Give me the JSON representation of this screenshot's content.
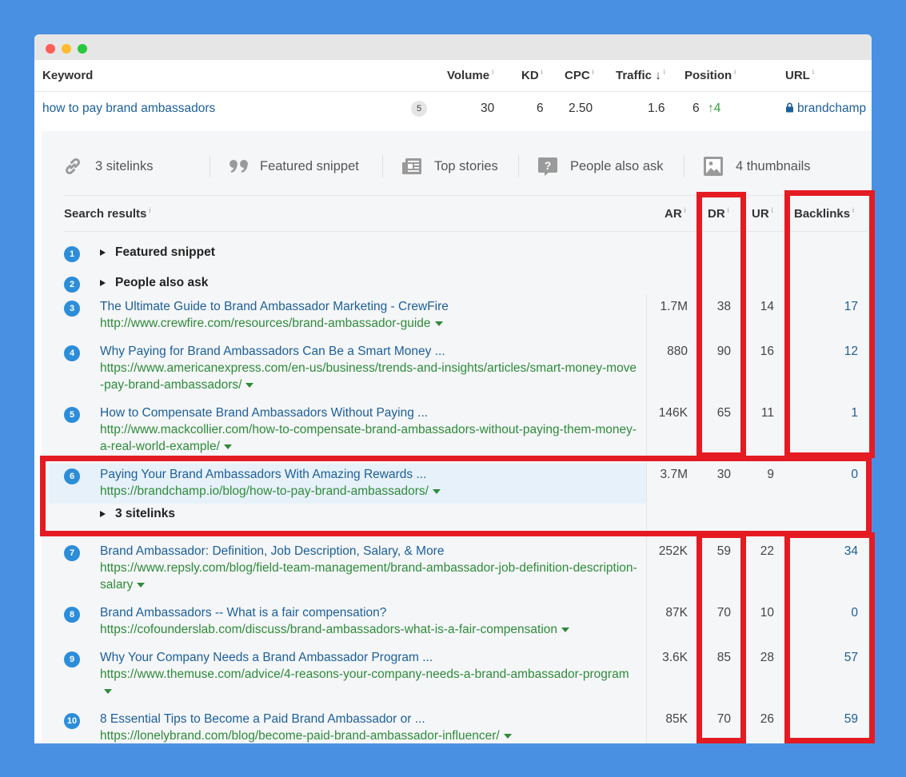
{
  "keyword_table": {
    "headers": {
      "keyword": "Keyword",
      "volume": "Volume",
      "kd": "KD",
      "cpc": "CPC",
      "traffic": "Traffic",
      "traffic_sort": "↓",
      "position": "Position",
      "url": "URL",
      "info": "i"
    },
    "row": {
      "keyword": "how to pay brand ambassadors",
      "badge": "5",
      "volume": "30",
      "kd": "6",
      "cpc": "2.50",
      "traffic": "1.6",
      "position": "6",
      "position_change": "↑4",
      "url": "brandchamp"
    }
  },
  "serp_features": [
    {
      "icon": "link-icon",
      "label": "3 sitelinks"
    },
    {
      "icon": "quote-icon",
      "label": "Featured snippet"
    },
    {
      "icon": "newspaper-icon",
      "label": "Top stories"
    },
    {
      "icon": "question-icon",
      "label": "People also ask"
    },
    {
      "icon": "image-icon",
      "label": "4 thumbnails"
    }
  ],
  "results_table": {
    "headers": {
      "search_results": "Search results",
      "ar": "AR",
      "dr": "DR",
      "ur": "UR",
      "backlinks": "Backlinks"
    },
    "rows": [
      {
        "num": "1",
        "expander": "Featured snippet"
      },
      {
        "num": "2",
        "expander": "People also ask"
      },
      {
        "num": "3",
        "title": "The Ultimate Guide to Brand Ambassador Marketing - CrewFire",
        "url": "http://www.crewfire.com/resources/brand-ambassador-guide",
        "ar": "1.7M",
        "dr": "38",
        "ur": "14",
        "backlinks": "17"
      },
      {
        "num": "4",
        "title": "Why Paying for Brand Ambassadors Can Be a Smart Money ...",
        "url": "https://www.americanexpress.com/en-us/business/trends-and-insights/articles/smart-money-move-pay-brand-ambassadors/",
        "ar": "880",
        "dr": "90",
        "ur": "16",
        "backlinks": "12"
      },
      {
        "num": "5",
        "title": "How to Compensate Brand Ambassadors Without Paying ...",
        "url": "http://www.mackcollier.com/how-to-compensate-brand-ambassadors-without-paying-them-money-a-real-world-example/",
        "ar": "146K",
        "dr": "65",
        "ur": "11",
        "backlinks": "1"
      },
      {
        "num": "6",
        "title": "Paying Your Brand Ambassadors With Amazing Rewards ...",
        "url": "https://brandchamp.io/blog/how-to-pay-brand-ambassadors/",
        "ar": "3.7M",
        "dr": "30",
        "ur": "9",
        "backlinks": "0",
        "sub_expander": "3 sitelinks"
      },
      {
        "num": "7",
        "title": "Brand Ambassador: Definition, Job Description, Salary, & More",
        "url": "https://www.repsly.com/blog/field-team-management/brand-ambassador-job-definition-description-salary",
        "ar": "252K",
        "dr": "59",
        "ur": "22",
        "backlinks": "34"
      },
      {
        "num": "8",
        "title": "Brand Ambassadors -- What is a fair compensation?",
        "url": "https://cofounderslab.com/discuss/brand-ambassadors-what-is-a-fair-compensation",
        "ar": "87K",
        "dr": "70",
        "ur": "10",
        "backlinks": "0"
      },
      {
        "num": "9",
        "title": "Why Your Company Needs a Brand Ambassador Program ...",
        "url": "https://www.themuse.com/advice/4-reasons-your-company-needs-a-brand-ambassador-program",
        "ar": "3.6K",
        "dr": "85",
        "ur": "28",
        "backlinks": "57"
      },
      {
        "num": "10",
        "title": "8 Essential Tips to Become a Paid Brand Ambassador or ...",
        "url": "https://lonelybrand.com/blog/become-paid-brand-ambassador-influencer/",
        "ar": "85K",
        "dr": "70",
        "ur": "26",
        "backlinks": "59"
      }
    ]
  },
  "colors": {
    "background": "#4a90e2",
    "highlight_box": "#e41b23",
    "link": "#1c5f9a",
    "url_green": "#2e8b3a",
    "badge_blue": "#2c8dd9"
  }
}
